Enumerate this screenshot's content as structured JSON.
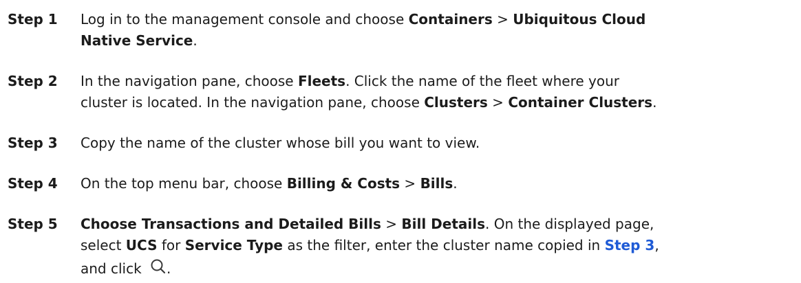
{
  "steps": [
    {
      "label": "Step 1",
      "parts": [
        {
          "t": "Log in to the management console and choose "
        },
        {
          "b": "Containers"
        },
        {
          "t": " > "
        },
        {
          "b": "Ubiquitous Cloud"
        },
        {
          "br": true
        },
        {
          "b": "Native Service"
        },
        {
          "t": "."
        }
      ]
    },
    {
      "label": "Step 2",
      "parts": [
        {
          "t": "In the navigation pane, choose "
        },
        {
          "b": "Fleets"
        },
        {
          "t": ". Click the name of the fleet where your"
        },
        {
          "br": true
        },
        {
          "t": "cluster is located. In the navigation pane, choose "
        },
        {
          "b": "Clusters"
        },
        {
          "t": " > "
        },
        {
          "b": "Container Clusters"
        },
        {
          "t": "."
        }
      ]
    },
    {
      "label": "Step 3",
      "parts": [
        {
          "t": "Copy the name of the cluster whose bill you want to view."
        }
      ]
    },
    {
      "label": "Step 4",
      "parts": [
        {
          "t": "On the top menu bar, choose "
        },
        {
          "b": "Billing & Costs"
        },
        {
          "t": " > "
        },
        {
          "b": "Bills"
        },
        {
          "t": "."
        }
      ]
    },
    {
      "label": "Step 5",
      "parts": [
        {
          "b": "Choose "
        },
        {
          "b": "Transactions and Detailed Bills"
        },
        {
          "t": " > "
        },
        {
          "b": "Bill Details"
        },
        {
          "t": ". On the displayed page,"
        },
        {
          "br": true
        },
        {
          "t": "select "
        },
        {
          "b": "UCS"
        },
        {
          "t": " for "
        },
        {
          "b": "Service Type"
        },
        {
          "t": " as the filter, enter the cluster name copied in "
        },
        {
          "link": "Step 3"
        },
        {
          "t": ","
        },
        {
          "br": true
        },
        {
          "t": "and click "
        },
        {
          "icon": "search-icon"
        },
        {
          "t": "."
        }
      ]
    }
  ],
  "colors": {
    "text": "#1b1b1b",
    "link": "#1f5bd6"
  }
}
